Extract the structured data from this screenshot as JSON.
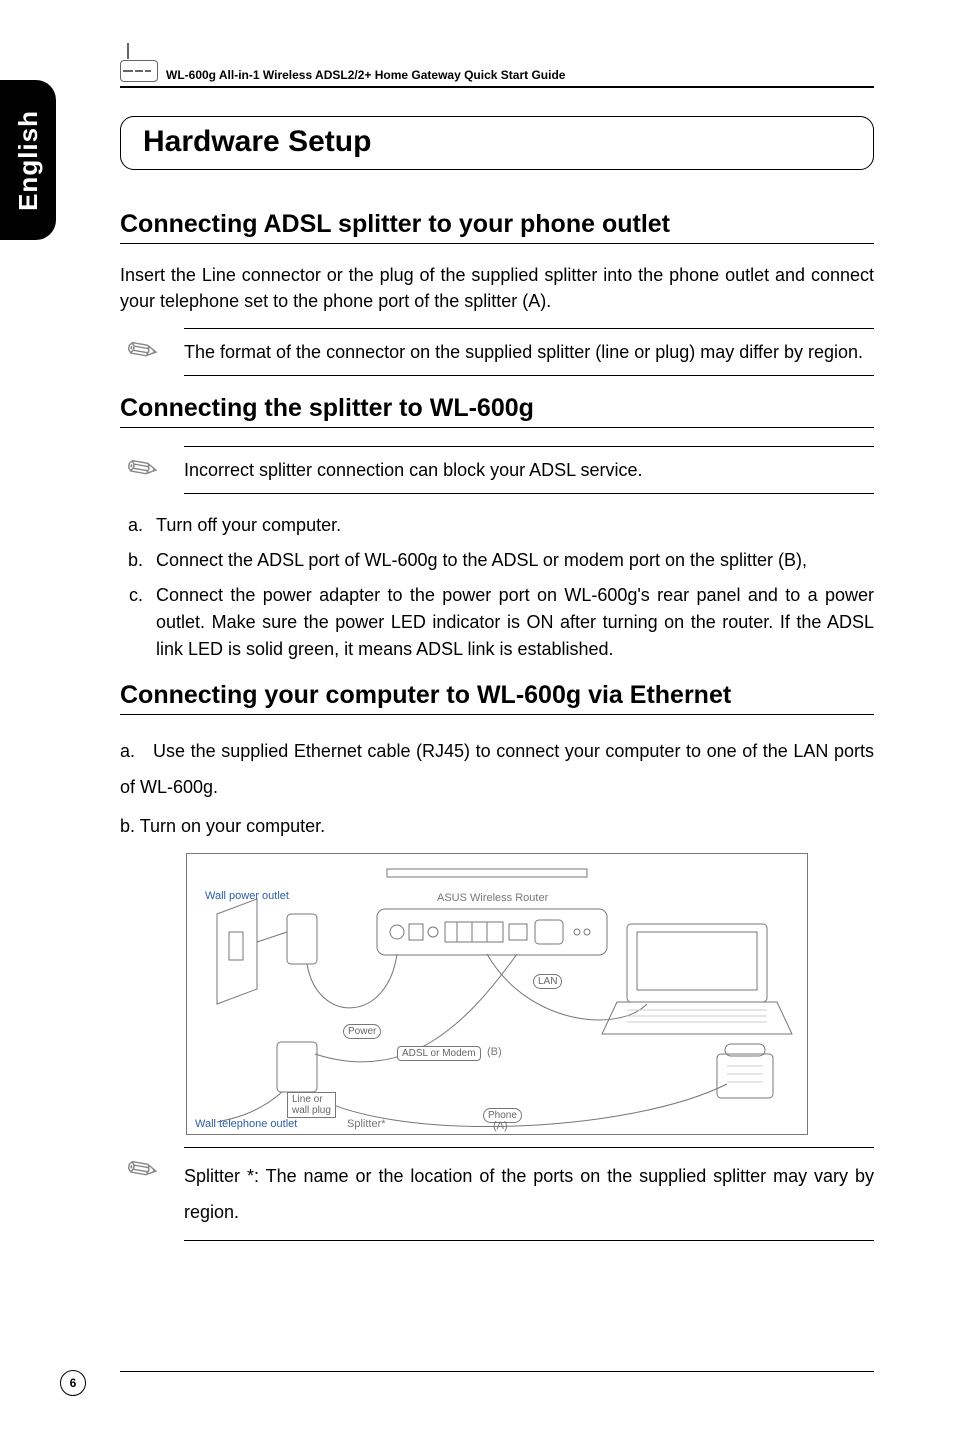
{
  "sideTab": "English",
  "header": {
    "text": "WL-600g All-in-1 Wireless ADSL2/2+ Home Gateway Quick Start Guide"
  },
  "title": "Hardware Setup",
  "sections": {
    "s1": {
      "heading": "Connecting ADSL splitter to your phone outlet",
      "body": "Insert the Line connector or the plug of the supplied splitter into the phone outlet and connect your telephone set to the phone port of the splitter (A).",
      "note": "The format of the connector on the supplied splitter (line or plug) may differ by region."
    },
    "s2": {
      "heading": "Connecting the splitter to WL-600g",
      "note": "Incorrect splitter connection can block your ADSL service.",
      "items": {
        "a": "Turn off your computer.",
        "b": "Connect the ADSL port of WL-600g to the ADSL or modem port on the splitter (B),",
        "c": "Connect the power adapter to the power port on WL-600g's rear panel and to a power outlet. Make sure the power LED indicator is ON after turning on the router. If the ADSL link LED is solid green, it means ADSL link is established."
      }
    },
    "s3": {
      "heading": "Connecting your computer to WL-600g via Ethernet",
      "item_a": "a. Use the supplied Ethernet cable (RJ45) to connect your computer to one of the LAN ports of WL-600g.",
      "item_b": "b. Turn on your computer.",
      "note": "Splitter *:  The name or the location of the ports on the supplied splitter may vary by region."
    }
  },
  "diagram": {
    "labels": {
      "wall_power": "Wall power outlet",
      "asus": "ASUS Wireless Router",
      "lan": "LAN",
      "power": "Power",
      "adsl_modem": "ADSL or Modem",
      "b": "(B)",
      "line_plug_1": "Line or",
      "line_plug_2": "wall plug",
      "phone": "Phone",
      "wall_phone": "Wall telephone outlet",
      "splitter": "Splitter*",
      "a": "(A)"
    }
  },
  "pageNumber": "6"
}
